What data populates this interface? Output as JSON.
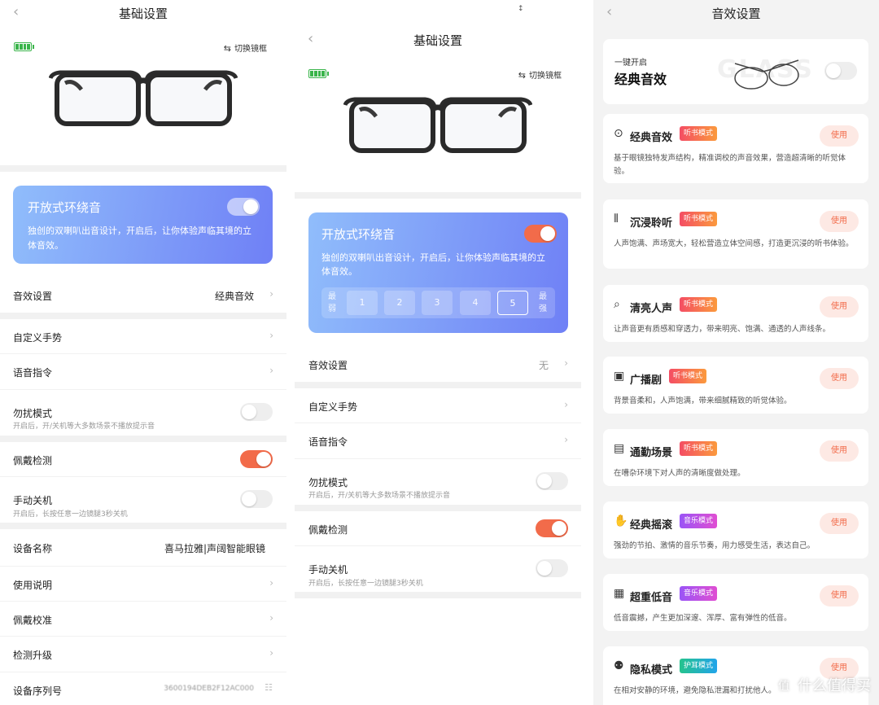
{
  "panel1": {
    "title": "基础设置",
    "switch_frame": "切换镜框",
    "surround": {
      "title": "开放式环绕音",
      "desc_line1": "独创的双喇叭出音设计，开启后，让你体验声临其境的立",
      "desc_line2": "体音效。",
      "enabled": true
    },
    "sound_setting": {
      "label": "音效设置",
      "value": "经典音效"
    },
    "custom_gesture": "自定义手势",
    "voice_command": "语音指令",
    "dnd": {
      "label": "勿扰模式",
      "sub": "开启后，开/关机等大多数场景不播放提示音",
      "enabled": false
    },
    "wear_detect": {
      "label": "佩戴检测",
      "enabled": true
    },
    "manual_off": {
      "label": "手动关机",
      "sub": "开启后，长按任意一边镜腿3秒关机",
      "enabled": false
    },
    "device_name": {
      "label": "设备名称",
      "value": "喜马拉雅|声阔智能眼镜"
    },
    "manual": "使用说明",
    "calibration": "佩戴校准",
    "upgrade": "检测升级",
    "serial": {
      "label": "设备序列号",
      "value": "3600194DEB2F12AC000"
    }
  },
  "panel2": {
    "title": "基础设置",
    "switch_frame": "切换镜框",
    "surround": {
      "title": "开放式环绕音",
      "desc_line1": "独创的双喇叭出音设计，开启后，让你体验声临其境的立",
      "desc_line2": "体音效。",
      "enabled": true,
      "min_label_1": "最",
      "min_label_2": "弱",
      "max_label_1": "最",
      "max_label_2": "强",
      "levels": [
        "1",
        "2",
        "3",
        "4",
        "5"
      ],
      "selected_level": "5"
    },
    "sound_setting": {
      "label": "音效设置",
      "value": "无"
    },
    "custom_gesture": "自定义手势",
    "voice_command": "语音指令",
    "dnd": {
      "label": "勿扰模式",
      "sub": "开启后，开/关机等大多数场景不播放提示音",
      "enabled": false
    },
    "wear_detect": {
      "label": "佩戴检测",
      "enabled": true
    },
    "manual_off": {
      "label": "手动关机",
      "sub": "开启后，长按任意一边镜腿3秒关机",
      "enabled": false
    }
  },
  "panel3": {
    "title": "音效设置",
    "top": {
      "small": "一键开启",
      "big": "经典音效",
      "bg_word": "GLASS",
      "enabled": false
    },
    "use_label": "使用",
    "cards": [
      {
        "title": "经典音效",
        "badge": "听书模式",
        "desc": "基于眼镜独特发声结构，精准调校的声音效果，营造超清晰的听觉体验。"
      },
      {
        "title": "沉浸聆听",
        "badge": "听书模式",
        "desc": "人声饱满、声场宽大，轻松营造立体空间感，打造更沉浸的听书体验。"
      },
      {
        "title": "清亮人声",
        "badge": "听书模式",
        "desc": "让声音更有质感和穿透力，带来明亮、饱满、通透的人声线条。"
      },
      {
        "title": "广播剧",
        "badge": "听书模式",
        "desc": "背景音柔和，人声饱满，带来细腻精致的听觉体验。"
      },
      {
        "title": "通勤场景",
        "badge": "听书模式",
        "desc": "在嘈杂环境下对人声的清晰度做处理。"
      },
      {
        "title": "经典摇滚",
        "badge": "音乐模式",
        "desc": "强劲的节拍、激情的音乐节奏，用力感受生活，表达自己。"
      },
      {
        "title": "超重低音",
        "badge": "音乐模式",
        "desc": "低音震撼，产生更加深邃、浑厚、富有弹性的低音。"
      },
      {
        "title": "隐私模式",
        "badge": "护耳模式",
        "desc": "在相对安静的环境，避免隐私泄漏和打扰他人。"
      }
    ],
    "watermark": "什么值得买",
    "watermark_icon": "值"
  }
}
